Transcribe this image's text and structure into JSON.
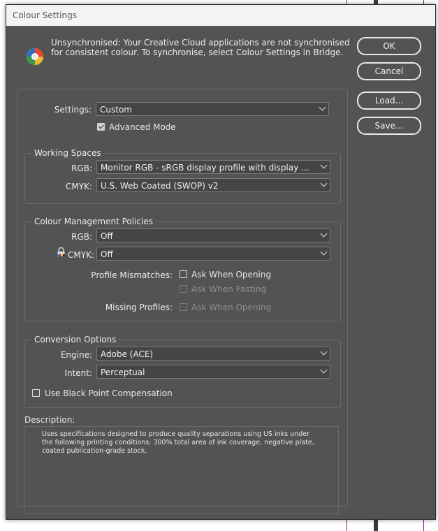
{
  "window": {
    "title": "Colour Settings"
  },
  "message": "Unsynchronised: Your Creative Cloud applications are not synchronised for consistent colour. To synchronise, select Colour Settings in Bridge.",
  "buttons": {
    "ok": "OK",
    "cancel": "Cancel",
    "load": "Load...",
    "save": "Save..."
  },
  "settings": {
    "label": "Settings:",
    "value": "Custom",
    "advanced_mode_label": "Advanced Mode",
    "advanced_mode_checked": true
  },
  "working_spaces": {
    "title": "Working Spaces",
    "rgb_label": "RGB:",
    "rgb_value": "Monitor RGB - sRGB display profile with display hard...",
    "cmyk_label": "CMYK:",
    "cmyk_value": "U.S. Web Coated (SWOP) v2"
  },
  "policies": {
    "title": "Colour Management Policies",
    "rgb_label": "RGB:",
    "rgb_value": "Off",
    "cmyk_label": "CMYK:",
    "cmyk_value": "Off",
    "profile_mismatches_label": "Profile Mismatches:",
    "ask_when_opening": "Ask When Opening",
    "ask_when_pasting": "Ask When Pasting",
    "missing_profiles_label": "Missing Profiles:",
    "missing_ask_when_opening": "Ask When Opening"
  },
  "conversion": {
    "title": "Conversion Options",
    "engine_label": "Engine:",
    "engine_value": "Adobe (ACE)",
    "intent_label": "Intent:",
    "intent_value": "Perceptual",
    "black_point_label": "Use Black Point Compensation"
  },
  "description": {
    "label": "Description:",
    "text": "Uses specifications designed to produce quality separations using US inks under the following printing conditions: 300% total area of ink coverage, negative plate, coated publication-grade stock."
  },
  "colors": {
    "dialog_bg": "#535353",
    "titlebar_bg": "#f3f3f3",
    "accent_line": "#8a1f8a"
  }
}
